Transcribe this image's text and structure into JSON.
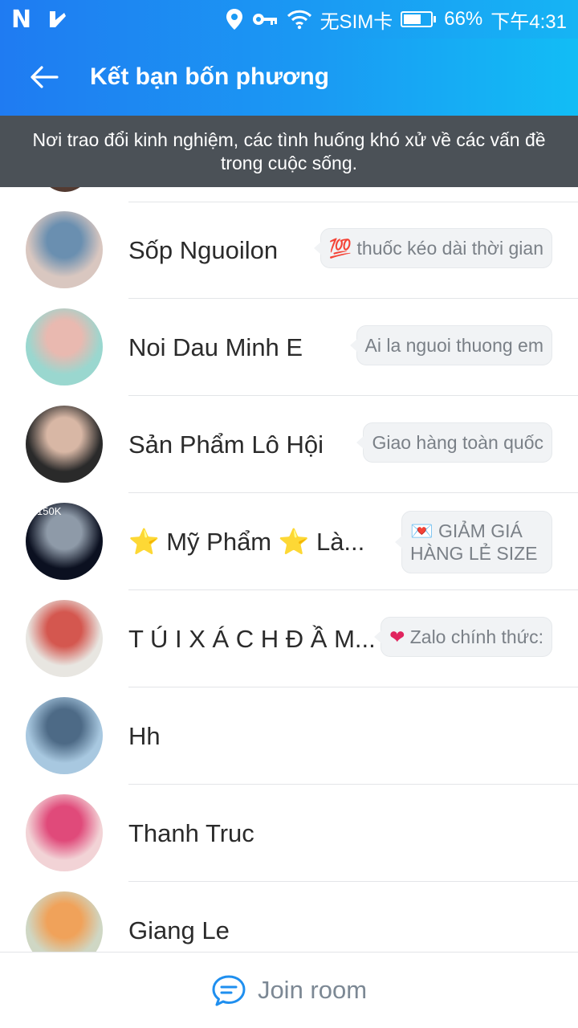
{
  "status": {
    "sim": "无SIM卡",
    "battery_percent": 66,
    "battery_label": "66%",
    "time": "下午4:31"
  },
  "header": {
    "title": "Kết bạn bốn phương",
    "back_icon": "arrow-left-icon"
  },
  "banner": {
    "text": "Nơi trao đổi kinh nghiệm, các tình huống khó xử về các vấn đề trong cuộc sống."
  },
  "members": [
    {
      "name": "Sốp Nguoilon",
      "status_emoji": "💯",
      "status": "thuốc kéo dài thời gian",
      "avatar_colors": [
        "#d9c7c0",
        "#6a8fb0"
      ]
    },
    {
      "name": "Noi Dau Minh E",
      "status_emoji": "",
      "status": "Ai la nguoi thuong em",
      "avatar_colors": [
        "#9ad7cf",
        "#e9b9b0"
      ]
    },
    {
      "name": "Sản Phẩm Lô Hội",
      "status_emoji": "",
      "status": "Giao hàng toàn quốc",
      "avatar_colors": [
        "#2a2a2a",
        "#d8b7a5"
      ]
    },
    {
      "name": "⭐ Mỹ Phẩm ⭐ Là...",
      "status_emoji": "💌",
      "status": "GIẢM GIÁ HÀNG LẺ SIZE",
      "avatar_colors": [
        "#0b1020",
        "#8e9aa8"
      ],
      "avatar_text": "150K"
    },
    {
      "name": "T Ú I X Á C H Đ Ầ M...",
      "status_emoji": "❤",
      "status": "Zalo chính thức:",
      "avatar_colors": [
        "#e8e6e1",
        "#d4574f"
      ]
    },
    {
      "name": "Hh",
      "status_emoji": "",
      "status": "",
      "avatar_colors": [
        "#a8c8e0",
        "#4d6a86"
      ]
    },
    {
      "name": "Thanh Truc",
      "status_emoji": "",
      "status": "",
      "avatar_colors": [
        "#f2d3d6",
        "#e04a7a"
      ]
    },
    {
      "name": "Giang Le",
      "status_emoji": "",
      "status": "",
      "avatar_colors": [
        "#cfd7c4",
        "#f0a25a"
      ]
    }
  ],
  "footer": {
    "join_label": "Join room",
    "join_icon": "chat-bubble-icon"
  }
}
